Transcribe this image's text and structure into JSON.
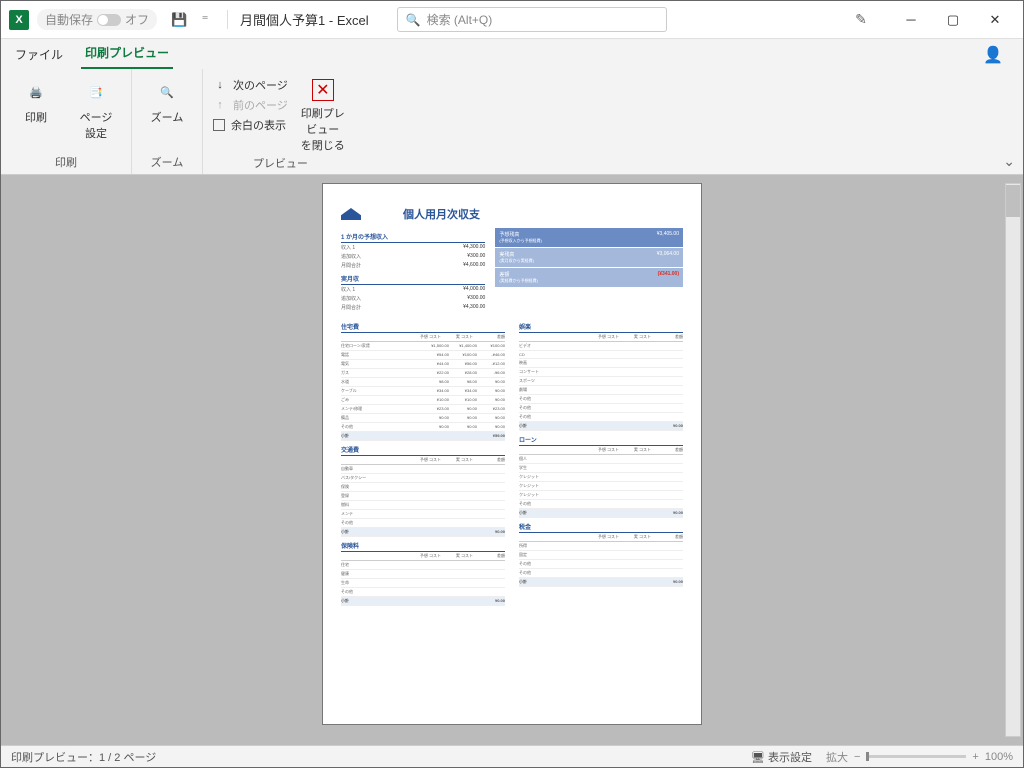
{
  "titlebar": {
    "autosave": "自動保存",
    "off": "オフ",
    "title": "月間個人予算1  -  Excel",
    "search_placeholder": "検索 (Alt+Q)"
  },
  "tabs": {
    "file": "ファイル",
    "printpreview": "印刷プレビュー"
  },
  "ribbon": {
    "print": "印刷",
    "pagesetup": "ページ\n設定",
    "zoom": "ズーム",
    "nextpage": "次のページ",
    "prevpage": "前のページ",
    "margins": "余白の表示",
    "closepreview": "印刷プレビュー\nを閉じる",
    "grp_print": "印刷",
    "grp_zoom": "ズーム",
    "grp_preview": "プレビュー"
  },
  "sheet": {
    "title": "個人用月次収支",
    "income_title": "1 か月の予想収入",
    "income": [
      {
        "k": "収入 1",
        "v": "¥4,300.00"
      },
      {
        "k": "追加収入",
        "v": "¥300.00"
      },
      {
        "k": "月間合計",
        "v": "¥4,600.00"
      }
    ],
    "actual_income_title": "実月収",
    "actual_income": [
      {
        "k": "収入 1",
        "v": "¥4,000.00"
      },
      {
        "k": "追加収入",
        "v": "¥300.00"
      },
      {
        "k": "月間合計",
        "v": "¥4,300.00"
      }
    ],
    "summary": [
      {
        "label": "予想残高",
        "sub": "(予想収入から予想経費)",
        "value": "¥3,405.00"
      },
      {
        "label": "実残高",
        "sub": "(実月収から実経費)",
        "value": "¥3,064.00"
      },
      {
        "label": "差額",
        "sub": "(実経費から予想経費)",
        "value": "(¥341.00)",
        "neg": true
      }
    ],
    "cat_headers": [
      "予想\nコスト",
      "実\nコスト",
      "差額"
    ],
    "housing": {
      "title": "住宅費",
      "rows": [
        {
          "lbl": "住宅ローン/家賃",
          "a": "¥1,500.00",
          "b": "¥1,400.00",
          "c": "¥100.00"
        },
        {
          "lbl": "電話",
          "a": "¥54.00",
          "b": "¥100.00",
          "c": "-¥46.00"
        },
        {
          "lbl": "電気",
          "a": "¥44.00",
          "b": "¥56.00",
          "c": "-¥12.00"
        },
        {
          "lbl": "ガス",
          "a": "¥22.00",
          "b": "¥28.00",
          "c": "-¥6.00"
        },
        {
          "lbl": "水道",
          "a": "¥8.00",
          "b": "¥8.00",
          "c": "¥0.00"
        },
        {
          "lbl": "ケーブル",
          "a": "¥34.00",
          "b": "¥34.00",
          "c": "¥0.00"
        },
        {
          "lbl": "ごみ",
          "a": "¥10.00",
          "b": "¥10.00",
          "c": "¥0.00"
        },
        {
          "lbl": "メンテ/修理",
          "a": "¥23.00",
          "b": "¥0.00",
          "c": "¥23.00"
        },
        {
          "lbl": "備品",
          "a": "¥0.00",
          "b": "¥0.00",
          "c": "¥0.00"
        },
        {
          "lbl": "その他",
          "a": "¥0.00",
          "b": "¥0.00",
          "c": "¥0.00"
        }
      ],
      "total": {
        "lbl": "小計",
        "a": "",
        "b": "",
        "c": "¥59.00"
      }
    },
    "transport": {
      "title": "交通費",
      "rows": [
        {
          "lbl": "自動車",
          "a": "",
          "b": "",
          "c": ""
        },
        {
          "lbl": "バス/タクシー",
          "a": "",
          "b": "",
          "c": ""
        },
        {
          "lbl": "保険",
          "a": "",
          "b": "",
          "c": ""
        },
        {
          "lbl": "登録",
          "a": "",
          "b": "",
          "c": ""
        },
        {
          "lbl": "燃料",
          "a": "",
          "b": "",
          "c": ""
        },
        {
          "lbl": "メンテ",
          "a": "",
          "b": "",
          "c": ""
        },
        {
          "lbl": "その他",
          "a": "",
          "b": "",
          "c": ""
        }
      ],
      "total": {
        "lbl": "小計",
        "a": "",
        "b": "",
        "c": "¥0.00"
      }
    },
    "insurance": {
      "title": "保険料",
      "rows": [
        {
          "lbl": "住宅",
          "a": "",
          "b": "",
          "c": ""
        },
        {
          "lbl": "健康",
          "a": "",
          "b": "",
          "c": ""
        },
        {
          "lbl": "生命",
          "a": "",
          "b": "",
          "c": ""
        },
        {
          "lbl": "その他",
          "a": "",
          "b": "",
          "c": ""
        }
      ],
      "total": {
        "lbl": "小計",
        "a": "",
        "b": "",
        "c": "¥0.00"
      }
    },
    "entertainment": {
      "title": "娯楽",
      "rows": [
        {
          "lbl": "ビデオ",
          "a": "",
          "b": "",
          "c": ""
        },
        {
          "lbl": "CD",
          "a": "",
          "b": "",
          "c": ""
        },
        {
          "lbl": "映画",
          "a": "",
          "b": "",
          "c": ""
        },
        {
          "lbl": "コンサート",
          "a": "",
          "b": "",
          "c": ""
        },
        {
          "lbl": "スポーツ",
          "a": "",
          "b": "",
          "c": ""
        },
        {
          "lbl": "劇場",
          "a": "",
          "b": "",
          "c": ""
        },
        {
          "lbl": "その他",
          "a": "",
          "b": "",
          "c": ""
        },
        {
          "lbl": "その他",
          "a": "",
          "b": "",
          "c": ""
        },
        {
          "lbl": "その他",
          "a": "",
          "b": "",
          "c": ""
        }
      ],
      "total": {
        "lbl": "小計",
        "a": "",
        "b": "",
        "c": "¥0.00"
      }
    },
    "loans": {
      "title": "ローン",
      "rows": [
        {
          "lbl": "個人",
          "a": "",
          "b": "",
          "c": ""
        },
        {
          "lbl": "学生",
          "a": "",
          "b": "",
          "c": ""
        },
        {
          "lbl": "クレジット",
          "a": "",
          "b": "",
          "c": ""
        },
        {
          "lbl": "クレジット",
          "a": "",
          "b": "",
          "c": ""
        },
        {
          "lbl": "クレジット",
          "a": "",
          "b": "",
          "c": ""
        },
        {
          "lbl": "その他",
          "a": "",
          "b": "",
          "c": ""
        }
      ],
      "total": {
        "lbl": "小計",
        "a": "",
        "b": "",
        "c": "¥0.00"
      }
    },
    "taxes": {
      "title": "税金",
      "rows": [
        {
          "lbl": "所得",
          "a": "",
          "b": "",
          "c": ""
        },
        {
          "lbl": "固定",
          "a": "",
          "b": "",
          "c": ""
        },
        {
          "lbl": "その他",
          "a": "",
          "b": "",
          "c": ""
        },
        {
          "lbl": "その他",
          "a": "",
          "b": "",
          "c": ""
        }
      ],
      "total": {
        "lbl": "小計",
        "a": "",
        "b": "",
        "c": "¥0.00"
      }
    }
  },
  "statusbar": {
    "page": "印刷プレビュー：1 / 2 ページ",
    "display": "表示設定",
    "zoom_label": "拡大",
    "zoom_pct": "100%"
  }
}
